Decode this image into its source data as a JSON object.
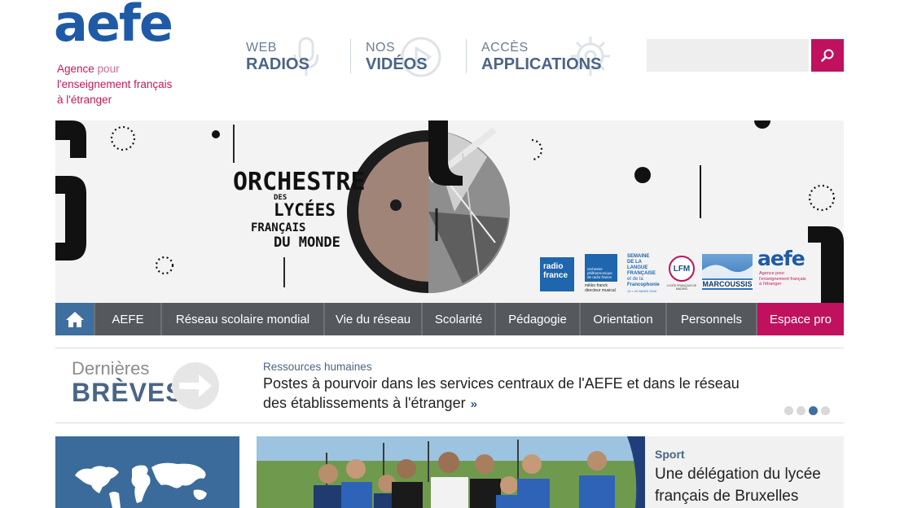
{
  "logo": {
    "wordmark": "aefe",
    "tagline_line1_a": "Agence",
    "tagline_line1_b": " pour",
    "tagline_line2": "l'enseignement français",
    "tagline_line3": "à l'étranger"
  },
  "topnav": {
    "radios_small": "WEB",
    "radios_big": "RADIOS",
    "videos_small": "NOS",
    "videos_big": "VIDÉOS",
    "apps_small": "ACCÈS",
    "apps_big": "APPLICATIONS"
  },
  "search": {
    "value": "",
    "placeholder": ""
  },
  "banner": {
    "title_1": "ORCHESTRE",
    "title_2": "DES",
    "title_3": "LYCÉES",
    "title_4": "FRANÇAIS",
    "title_5": "DU MONDE",
    "sponsors": {
      "radio_france_1": "radio",
      "radio_france_2": "france",
      "orchestre_line1": "orchestre",
      "orchestre_line2": "philharmonique",
      "orchestre_line3": "de radio france",
      "orchestre_line4": "mikko franck",
      "orchestre_line5": "directeur musical",
      "semaine_1": "SEMAINE",
      "semaine_2": "DE LA",
      "semaine_3": "LANGUE",
      "semaine_4": "FRANÇAISE",
      "semaine_5": "et de la",
      "semaine_6": "Francophonie",
      "semaine_7": "12 > 20 MARS 2016",
      "lfm_badge": "LFM",
      "lfm_name": "LYCÉE FRANÇAIS DE MADRID",
      "marcoussis": "MARCOUSSIS",
      "aefe_word": "aefe",
      "aefe_sub1": "Agence pour",
      "aefe_sub2": "l'enseignement français",
      "aefe_sub3": "à l'étranger"
    }
  },
  "mainnav": {
    "items": [
      {
        "label": "AEFE"
      },
      {
        "label": "Réseau scolaire mondial"
      },
      {
        "label": "Vie du réseau"
      },
      {
        "label": "Scolarité"
      },
      {
        "label": "Pédagogie"
      },
      {
        "label": "Orientation"
      },
      {
        "label": "Personnels"
      },
      {
        "label": "Espace pro"
      }
    ]
  },
  "breves": {
    "heading_1": "Dernières",
    "heading_2": "BRÈVES",
    "category": "Ressources humaines",
    "title": "Postes à pourvoir dans les services centraux de l'AEFE et dans le réseau des établissements à l'étranger",
    "more": "»"
  },
  "featured": {
    "category": "Sport",
    "title": "Une délégation du lycée français de Bruxelles"
  },
  "colors": {
    "brand_blue": "#1f5aa6",
    "brand_magenta": "#c0115e",
    "nav_dark": "#55595e",
    "nav_home": "#3e6f9e"
  },
  "icons": {
    "home": "home-icon",
    "search": "search-icon",
    "microphone": "microphone-icon",
    "play": "play-icon",
    "gear": "gear-icon",
    "arrow": "arrow-right-icon"
  }
}
